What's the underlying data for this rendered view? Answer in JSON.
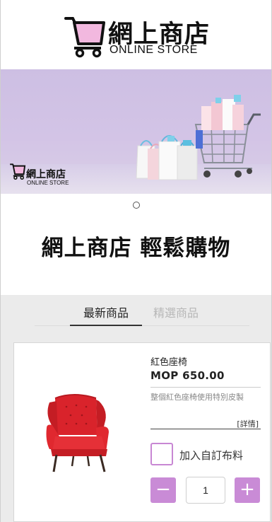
{
  "brand": {
    "title": "網上商店",
    "subtitle": "ONLINE STORE",
    "accent": "#f2b8df",
    "brand_color": "#c98bd6"
  },
  "banner": {
    "logo_title": "網上商店",
    "logo_subtitle": "ONLINE STORE",
    "slide_count": 1
  },
  "tagline": "網上商店 輕鬆購物",
  "tabs": [
    {
      "label": "最新商品",
      "active": true
    },
    {
      "label": "精選商品",
      "active": false
    }
  ],
  "product": {
    "name": "紅色座椅",
    "price": "MOP 650.00",
    "description": "整個紅色座椅使用特別皮製",
    "detail_link": "[詳情]",
    "option_label": "加入自訂布料",
    "option_checked": false,
    "minus_label": "−",
    "plus_label": "+",
    "quantity": "1"
  }
}
